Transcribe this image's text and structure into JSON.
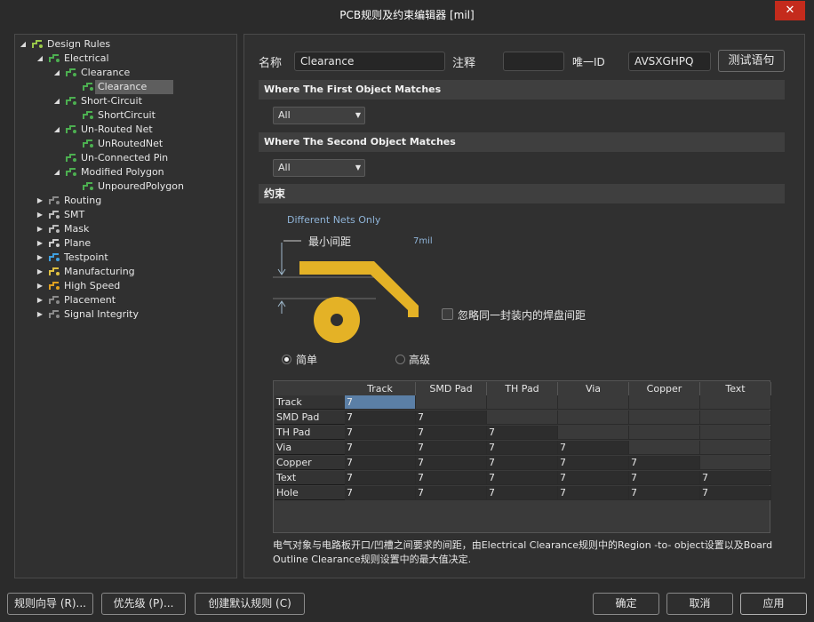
{
  "window": {
    "title": "PCB规则及约束编辑器 [mil]",
    "close_glyph": "✕"
  },
  "tree": {
    "items": [
      {
        "label": "Design Rules",
        "icon": "rules-folder-icon",
        "expanded": true
      },
      {
        "label": "Electrical",
        "icon": "electrical-rule-icon",
        "expanded": true
      },
      {
        "label": "Clearance",
        "icon": "clearance-rule-icon",
        "expanded": true
      },
      {
        "label": "Clearance",
        "icon": "clearance-rule-icon",
        "selected": true
      },
      {
        "label": "Short-Circuit",
        "icon": "short-circuit-rule-icon",
        "expanded": true
      },
      {
        "label": "ShortCircuit",
        "icon": "short-circuit-rule-icon"
      },
      {
        "label": "Un-Routed Net",
        "icon": "unrouted-net-rule-icon",
        "expanded": true
      },
      {
        "label": "UnRoutedNet",
        "icon": "unrouted-net-rule-icon"
      },
      {
        "label": "Un-Connected Pin",
        "icon": "unconnected-pin-rule-icon"
      },
      {
        "label": "Modified Polygon",
        "icon": "modified-polygon-rule-icon",
        "expanded": true
      },
      {
        "label": "UnpouredPolygon",
        "icon": "modified-polygon-rule-icon"
      },
      {
        "label": "Routing",
        "icon": "routing-icon"
      },
      {
        "label": "SMT",
        "icon": "smt-icon"
      },
      {
        "label": "Mask",
        "icon": "mask-icon"
      },
      {
        "label": "Plane",
        "icon": "plane-icon"
      },
      {
        "label": "Testpoint",
        "icon": "testpoint-icon"
      },
      {
        "label": "Manufacturing",
        "icon": "manufacturing-icon"
      },
      {
        "label": "High Speed",
        "icon": "high-speed-icon"
      },
      {
        "label": "Placement",
        "icon": "placement-icon"
      },
      {
        "label": "Signal Integrity",
        "icon": "signal-integrity-icon"
      }
    ]
  },
  "rule": {
    "name_label": "名称",
    "name_value": "Clearance",
    "comment_label": "注释",
    "comment_value": "",
    "id_label": "唯一ID",
    "id_value": "AVSXGHPQ",
    "test_button": "测试语句"
  },
  "first_match": {
    "title": "Where The First Object Matches",
    "value": "All"
  },
  "second_match": {
    "title": "Where The Second Object Matches",
    "value": "All"
  },
  "constraints": {
    "title": "约束",
    "net_scope": "Different Nets Only",
    "min_clearance_label": "最小间距",
    "min_clearance_value": "7mil",
    "ignore_pad_label": "忽略同一封装内的焊盘间距",
    "ignore_pad_checked": false,
    "mode_simple": "简单",
    "mode_advanced": "高级",
    "mode_selected": "simple",
    "diagram_color": "#e4b226"
  },
  "matrix": {
    "columns": [
      "Track",
      "SMD Pad",
      "TH Pad",
      "Via",
      "Copper",
      "Text"
    ],
    "rows": [
      {
        "label": "Track",
        "values": [
          "7",
          "",
          "",
          "",
          "",
          ""
        ]
      },
      {
        "label": "SMD Pad",
        "values": [
          "7",
          "7",
          "",
          "",
          "",
          ""
        ]
      },
      {
        "label": "TH Pad",
        "values": [
          "7",
          "7",
          "7",
          "",
          "",
          ""
        ]
      },
      {
        "label": "Via",
        "values": [
          "7",
          "7",
          "7",
          "7",
          "",
          ""
        ]
      },
      {
        "label": "Copper",
        "values": [
          "7",
          "7",
          "7",
          "7",
          "7",
          ""
        ]
      },
      {
        "label": "Text",
        "values": [
          "7",
          "7",
          "7",
          "7",
          "7",
          "7"
        ]
      },
      {
        "label": "Hole",
        "values": [
          "7",
          "7",
          "7",
          "7",
          "7",
          "7"
        ]
      }
    ]
  },
  "description": "电气对象与电路板开口/凹槽之间要求的间距，由Electrical Clearance规则中的Region -to- object设置以及Board Outline Clearance规则设置中的最大值决定.",
  "footer": {
    "rule_wizard": "规则向导 (R)...",
    "priorities": "优先级 (P)...",
    "create_default": "创建默认规则 (C)",
    "ok": "确定",
    "cancel": "取消",
    "apply": "应用"
  }
}
